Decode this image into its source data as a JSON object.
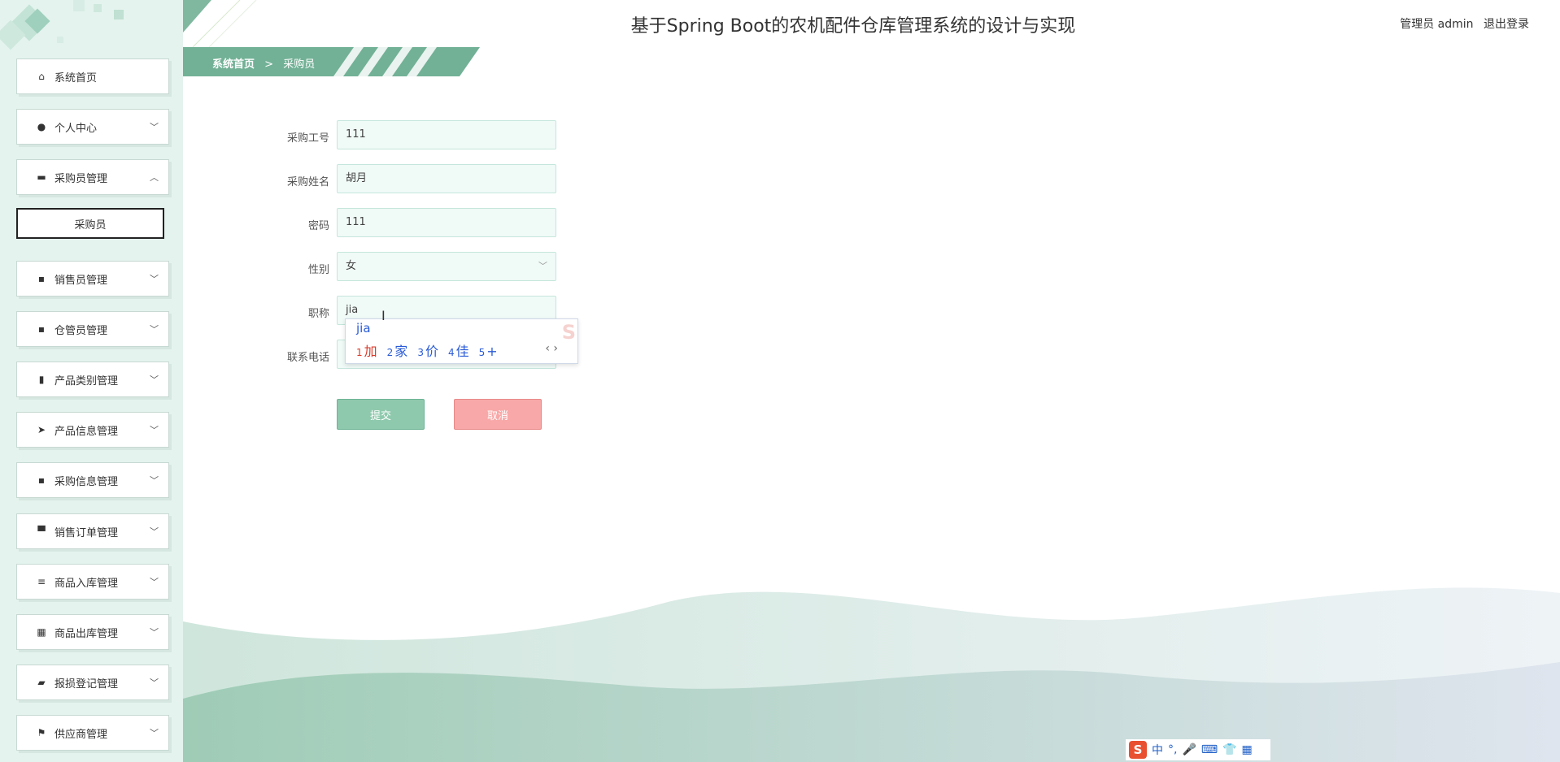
{
  "header": {
    "title": "基于Spring Boot的农机配件仓库管理系统的设计与实现",
    "user_label": "管理员 admin",
    "logout_label": "退出登录"
  },
  "breadcrumb": {
    "home": "系统首页",
    "separator": ">",
    "current": "采购员"
  },
  "sidebar": {
    "items": [
      {
        "label": "系统首页",
        "icon": "home-icon",
        "expandable": false
      },
      {
        "label": "个人中心",
        "icon": "user-icon",
        "expandable": true
      },
      {
        "label": "采购员管理",
        "icon": "briefcase-icon",
        "expandable": true,
        "expanded": true
      },
      {
        "label": "销售员管理",
        "icon": "grid-icon",
        "expandable": true
      },
      {
        "label": "仓管员管理",
        "icon": "grid-icon",
        "expandable": true
      },
      {
        "label": "产品类别管理",
        "icon": "bar-chart-icon",
        "expandable": true
      },
      {
        "label": "产品信息管理",
        "icon": "send-icon",
        "expandable": true
      },
      {
        "label": "采购信息管理",
        "icon": "grid-icon",
        "expandable": true
      },
      {
        "label": "销售订单管理",
        "icon": "stamp-icon",
        "expandable": true
      },
      {
        "label": "商品入库管理",
        "icon": "sliders-icon",
        "expandable": true
      },
      {
        "label": "商品出库管理",
        "icon": "apps-icon",
        "expandable": true
      },
      {
        "label": "报损登记管理",
        "icon": "wallet-icon",
        "expandable": true
      },
      {
        "label": "供应商管理",
        "icon": "flag-icon",
        "expandable": true
      }
    ],
    "submenu": {
      "label": "采购员"
    }
  },
  "form": {
    "fields": [
      {
        "label": "采购工号",
        "value": "111"
      },
      {
        "label": "采购姓名",
        "value": "胡月"
      },
      {
        "label": "密码",
        "value": "111"
      },
      {
        "label": "性别",
        "value": "女"
      },
      {
        "label": "职称",
        "value": "jia"
      },
      {
        "label": "联系电话",
        "value": ""
      }
    ],
    "submit_label": "提交",
    "cancel_label": "取消"
  },
  "ime": {
    "composition": "jia",
    "candidates": [
      {
        "num": "1",
        "text": "加"
      },
      {
        "num": "2",
        "text": "家"
      },
      {
        "num": "3",
        "text": "价"
      },
      {
        "num": "4",
        "text": "佳"
      },
      {
        "num": "5",
        "text": "+"
      }
    ],
    "logo": "S"
  },
  "imebar": {
    "logo": "S",
    "mode": "中",
    "punct": "°,",
    "mic": "🎤",
    "keyboard": "⌨",
    "skin": "👕",
    "tools": "▦"
  },
  "colors": {
    "accent": "#6db394",
    "sidebar_bg": "#e4f3ee",
    "submit": "#8fc9ad",
    "cancel": "#f8a8a8",
    "ime_text": "#2a5bd7"
  }
}
